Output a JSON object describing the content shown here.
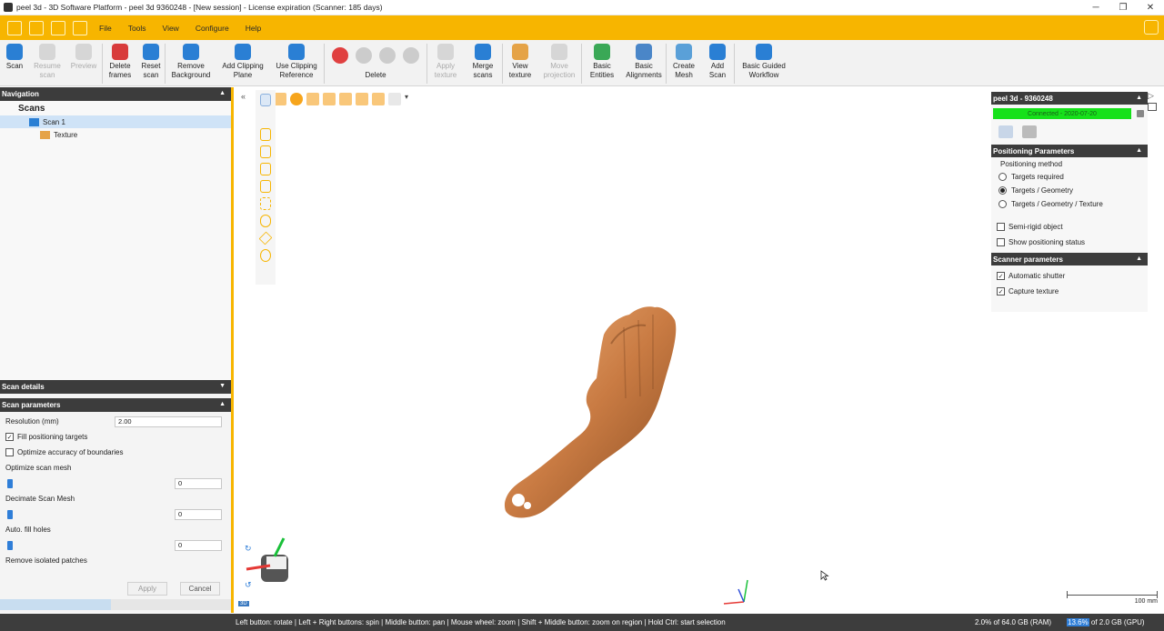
{
  "window": {
    "title": "peel 3d - 3D Software Platform - peel 3d 9360248 - [New session] - License expiration (Scanner: 185 days)"
  },
  "menu": [
    "File",
    "Tools",
    "View",
    "Configure",
    "Help"
  ],
  "ribbon": {
    "scan": "Scan",
    "resume_scan": "Resume\nscan",
    "preview": "Preview",
    "delete_frames": "Delete\nframes",
    "reset_scan": "Reset\nscan",
    "remove_background": "Remove\nBackground",
    "add_clipping_plane": "Add Clipping\nPlane",
    "use_clipping_reference": "Use Clipping\nReference",
    "delete": "Delete",
    "apply_texture": "Apply\ntexture",
    "merge_scans": "Merge\nscans",
    "view_texture": "View\ntexture",
    "move_projection": "Move\nprojection",
    "basic_entities": "Basic\nEntities",
    "basic_alignments": "Basic\nAlignments",
    "create_mesh": "Create\nMesh",
    "add_scan": "Add\nScan",
    "basic_guided_workflow": "Basic Guided\nWorkflow"
  },
  "navigation": {
    "header": "Navigation",
    "root": "Scans",
    "items": [
      "Scan 1",
      "Texture"
    ]
  },
  "scan_details": {
    "header": "Scan details",
    "params_header": "Scan parameters",
    "resolution_label": "Resolution (mm)",
    "resolution_value": "2.00",
    "fill_targets": "Fill positioning targets",
    "fill_targets_checked": true,
    "optimize_boundaries": "Optimize accuracy of boundaries",
    "optimize_boundaries_checked": false,
    "optimize_mesh": "Optimize scan mesh",
    "optimize_mesh_value": "0",
    "decimate": "Decimate Scan Mesh",
    "decimate_value": "0",
    "auto_fill": "Auto. fill holes",
    "auto_fill_value": "0",
    "remove_patches": "Remove isolated patches",
    "apply": "Apply",
    "cancel": "Cancel"
  },
  "device_panel": {
    "header": "peel 3d - 9360248",
    "status": "Connected - 2020-07-20",
    "positioning_header": "Positioning Parameters",
    "positioning_method": "Positioning method",
    "options": [
      "Targets required",
      "Targets / Geometry",
      "Targets / Geometry / Texture"
    ],
    "selected_option": 1,
    "semi_rigid": "Semi-rigid object",
    "show_status": "Show positioning status",
    "scanner_header": "Scanner parameters",
    "auto_shutter": "Automatic shutter",
    "capture_texture": "Capture texture"
  },
  "viewport": {
    "scale_label": "100 mm"
  },
  "statusbar": {
    "hint": "Left button: rotate  |  Left + Right buttons: spin  |  Middle button: pan  |  Mouse wheel: zoom  |  Shift + Middle button: zoom on region  |  Hold Ctrl: start selection",
    "ram": "2.0% of 64.0 GB (RAM)",
    "gpu_pct": "13.6%",
    "gpu_rest": " of 2.0 GB (GPU)"
  },
  "colors": {
    "accent": "#f7b500",
    "connected": "#16e11a",
    "dark_header": "#3c3c3c"
  }
}
